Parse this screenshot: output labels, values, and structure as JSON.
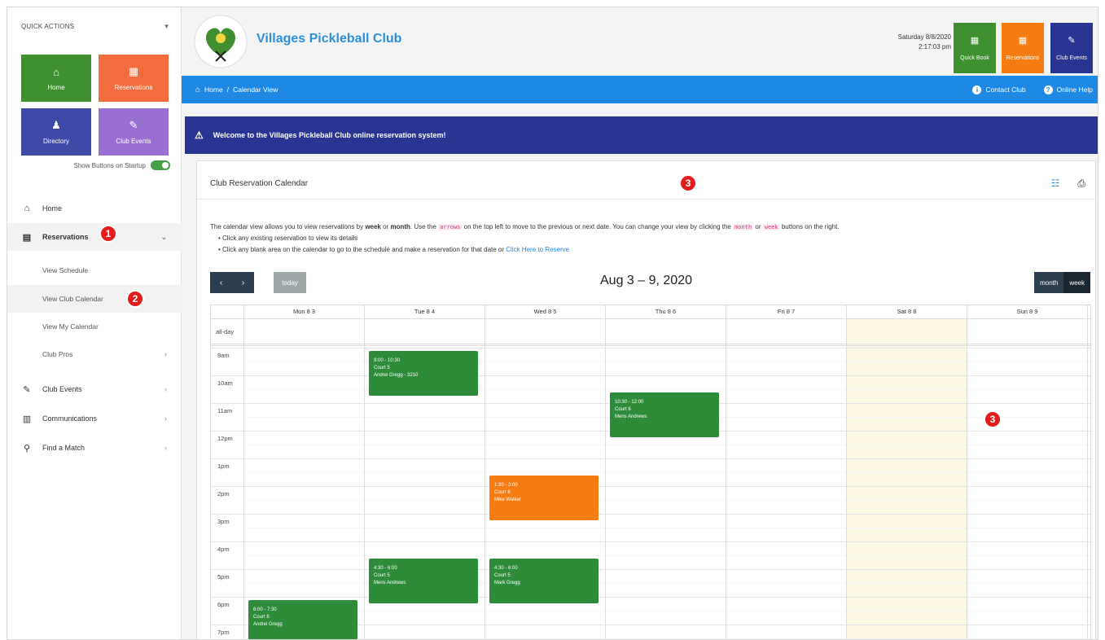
{
  "sidebar": {
    "quick_actions_label": "QUICK ACTIONS",
    "tiles": [
      {
        "label": "Home",
        "icon": "home-icon"
      },
      {
        "label": "Reservations",
        "icon": "calendar-icon"
      },
      {
        "label": "Directory",
        "icon": "users-icon"
      },
      {
        "label": "Club Events",
        "icon": "pickleball-paddle-icon"
      }
    ],
    "startup_label": "Show Buttons on Startup",
    "nav": [
      {
        "label": "Home",
        "icon": "home-outline-icon"
      },
      {
        "label": "Reservations",
        "icon": "calendar-icon"
      },
      {
        "label": "View Schedule"
      },
      {
        "label": "View Club Calendar"
      },
      {
        "label": "View My Calendar"
      },
      {
        "label": "Club Pros"
      },
      {
        "label": "Club Events",
        "icon": "paddle-icon"
      },
      {
        "label": "Communications",
        "icon": "document-icon"
      },
      {
        "label": "Find a Match",
        "icon": "search-icon"
      }
    ]
  },
  "header": {
    "brand": "Villages Pickleball Club",
    "date": "Saturday 8/8/2020",
    "time": "2:17:03 pm",
    "quick_buttons": [
      {
        "label": "Quick Book",
        "color": "#3f8f30"
      },
      {
        "label": "Reservations",
        "color": "#f47c10"
      },
      {
        "label": "Club Events",
        "color": "#283593"
      }
    ]
  },
  "breadcrumb": {
    "home": "Home",
    "separator": "/",
    "current": "Calendar View",
    "contact": "Contact Club",
    "help": "Online Help"
  },
  "welcome": "Welcome to the Villages Pickleball Club online reservation system!",
  "annotations": {
    "one": "1",
    "two": "2",
    "three": "3"
  },
  "calendar": {
    "title": "Club Reservation Calendar",
    "intro_a": "The calendar view allows you to view reservations by ",
    "intro_week": "week",
    "intro_or": " or ",
    "intro_month": "month",
    "intro_b": ". Use the ",
    "intro_arrows": "arrows",
    "intro_c": " on the top left to move to the previous or next date. You can change your view by clicking the ",
    "intro_month_code": "month",
    "intro_or2": " or ",
    "intro_week_code": "week",
    "intro_d": " buttons on the right.",
    "bullet1": "Click any existing reservation to view its details",
    "bullet2": "Click any blank area on the calendar to go to the schedule and make a reservation for that date or ",
    "bullet2_link": "Click Here to Reserve",
    "prev": "‹",
    "next": "›",
    "today": "today",
    "range": "Aug 3 – 9, 2020",
    "view_month": "month",
    "view_week": "week",
    "days": [
      "Mon 8 3",
      "Tue 8 4",
      "Wed 8 5",
      "Thu 8 6",
      "Fri 8 7",
      "Sat 8 8",
      "Sun 8 9"
    ],
    "allday": "all-day",
    "hours": [
      "9am",
      "10am",
      "11am",
      "12pm",
      "1pm",
      "2pm",
      "3pm",
      "4pm",
      "5pm",
      "6pm",
      "7pm"
    ],
    "events": [
      {
        "time": "9:00 - 10:30",
        "court": "Court 5",
        "name": "Andrei Gregg - 3210",
        "color": "green"
      },
      {
        "time": "10:30 - 12:00",
        "court": "Court 6",
        "name": "Mens Andrews",
        "color": "green"
      },
      {
        "time": "1:30 - 3:00",
        "court": "Court 6",
        "name": "Mike Walker",
        "color": "orange"
      },
      {
        "time": "4:30 - 6:00",
        "court": "Court 5",
        "name": "Mens Andrews",
        "color": "green"
      },
      {
        "time": "4:30 - 6:00",
        "court": "Court 5",
        "name": "Mark Gregg",
        "color": "green"
      },
      {
        "time": "6:00 - 7:30",
        "court": "Court 6",
        "name": "Andrei Gregg",
        "color": "green"
      }
    ]
  }
}
